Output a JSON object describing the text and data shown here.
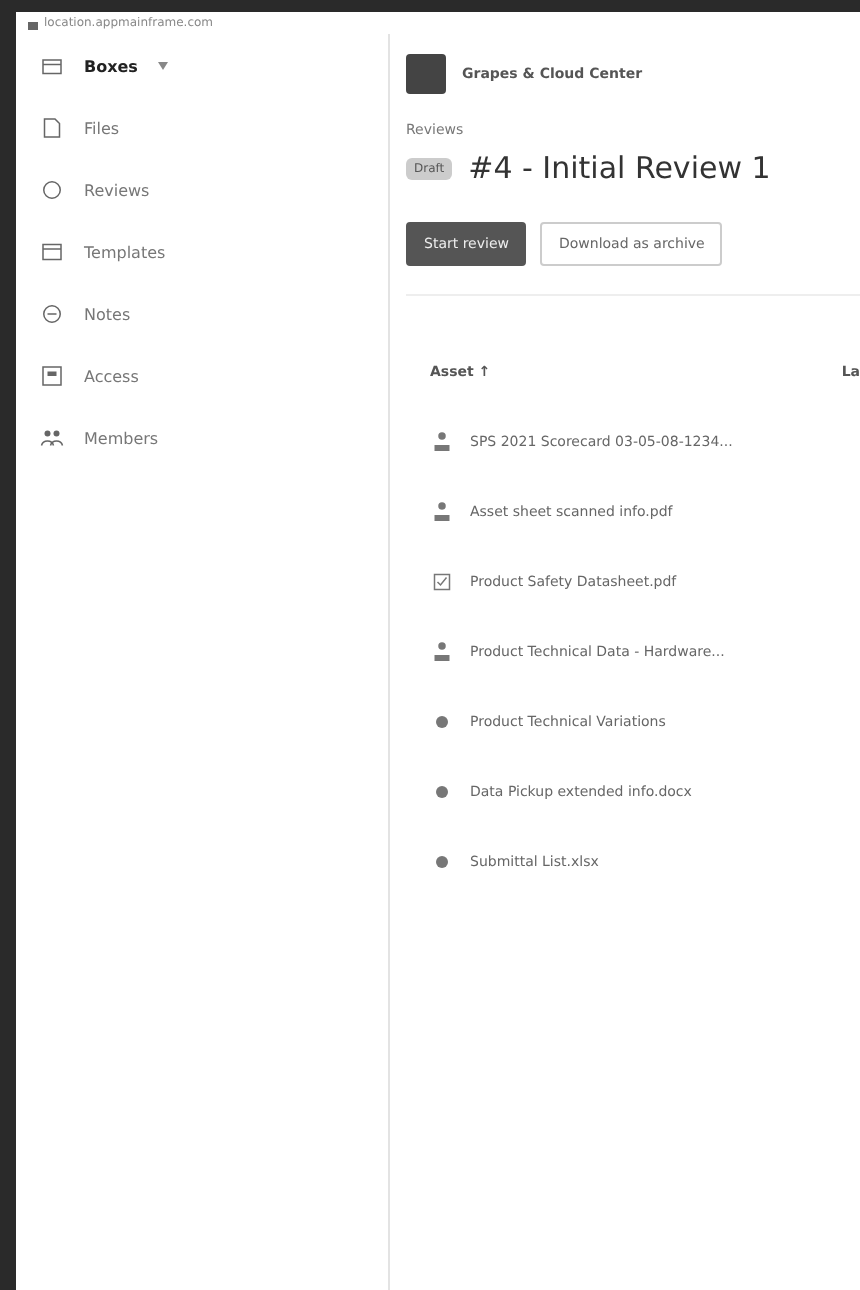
{
  "browser": {
    "url": "location.appmainframe.com"
  },
  "sidebar": {
    "workspace": "Boxes",
    "items": [
      {
        "label": "Files",
        "kind": "file"
      },
      {
        "label": "Reviews",
        "kind": "review"
      },
      {
        "label": "Templates",
        "kind": "template"
      },
      {
        "label": "Notes",
        "kind": "note"
      },
      {
        "label": "Access",
        "kind": "access"
      },
      {
        "label": "Members",
        "kind": "members"
      }
    ]
  },
  "header": {
    "org": "Grapes & Cloud Center"
  },
  "breadcrumb": "Reviews",
  "review": {
    "status": "Draft",
    "title": "#4 - Initial Review 1"
  },
  "actions": [
    {
      "label": "Start review",
      "primary": true
    },
    {
      "label": "Download as archive",
      "primary": false
    }
  ],
  "table": {
    "columns": [
      "Asset ↑",
      "La"
    ],
    "rows": [
      {
        "kind": "group",
        "name": "SPS 2021 Scorecard 03-05-08-1234..."
      },
      {
        "kind": "group",
        "name": "Asset sheet scanned info.pdf"
      },
      {
        "kind": "form",
        "name": "Product Safety Datasheet.pdf"
      },
      {
        "kind": "group",
        "name": "Product Technical Data - Hardware..."
      },
      {
        "kind": "doc",
        "name": "Product Technical Variations"
      },
      {
        "kind": "doc",
        "name": "Data Pickup extended info.docx"
      },
      {
        "kind": "doc",
        "name": "Submittal List.xlsx"
      }
    ]
  }
}
